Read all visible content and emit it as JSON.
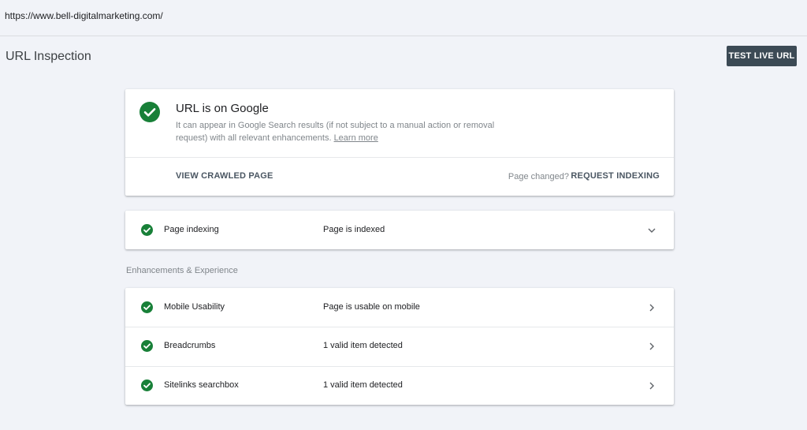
{
  "address_bar": {
    "url": "https://www.bell-digitalmarketing.com/"
  },
  "header": {
    "title": "URL Inspection",
    "test_live_label": "TEST LIVE URL"
  },
  "status": {
    "title": "URL is on Google",
    "description": "It can appear in Google Search results (if not subject to a manual action or removal request) with all relevant enhancements.",
    "learn_more": "Learn more",
    "view_crawled": "VIEW CRAWLED PAGE",
    "page_changed": "Page changed?",
    "request_indexing": "REQUEST INDEXING",
    "icon": "check-circle-icon"
  },
  "indexing": {
    "label": "Page indexing",
    "value": "Page is indexed",
    "icon": "check-circle-icon",
    "chevron": "chevron-down-icon"
  },
  "enhancements": {
    "section_title": "Enhancements & Experience",
    "items": [
      {
        "label": "Mobile Usability",
        "value": "Page is usable on mobile",
        "icon": "check-circle-icon"
      },
      {
        "label": "Breadcrumbs",
        "value": "1 valid item detected",
        "icon": "check-circle-icon"
      },
      {
        "label": "Sitelinks searchbox",
        "value": "1 valid item detected",
        "icon": "check-circle-icon"
      }
    ]
  },
  "colors": {
    "background": "#f1f3f8",
    "success_green": "#188038",
    "button_dark": "#3c4a55",
    "action_text": "#4a5662"
  }
}
